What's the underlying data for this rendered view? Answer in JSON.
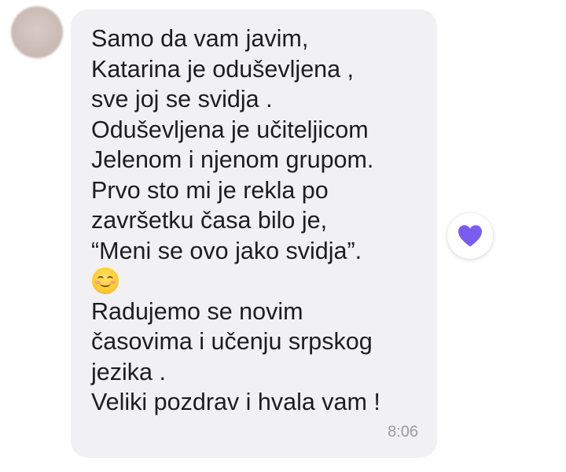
{
  "message": {
    "lines": [
      "Samo da vam javim,",
      "Katarina je oduševljena ,",
      "sve joj se svidja .",
      "Oduševljena je učiteljicom",
      "Jelenom i njenom grupom.",
      "Prvo sto mi je rekla po",
      "završetku časa bilo je,",
      "“Meni se ovo jako svidja”.",
      "Radujemo se novim",
      "časovima i učenju srpskog",
      "jezika .",
      "Veliki pozdrav i hvala vam !"
    ],
    "emoji_icon": "smiling-face-with-smiling-eyes-icon",
    "time": "8:06"
  },
  "reaction": {
    "icon": "purple-heart-icon",
    "color": "#7b5cf0"
  },
  "colors": {
    "bubble_bg": "#f1f1f3",
    "text": "#1d1d1f",
    "timestamp": "#9a9aa0"
  }
}
